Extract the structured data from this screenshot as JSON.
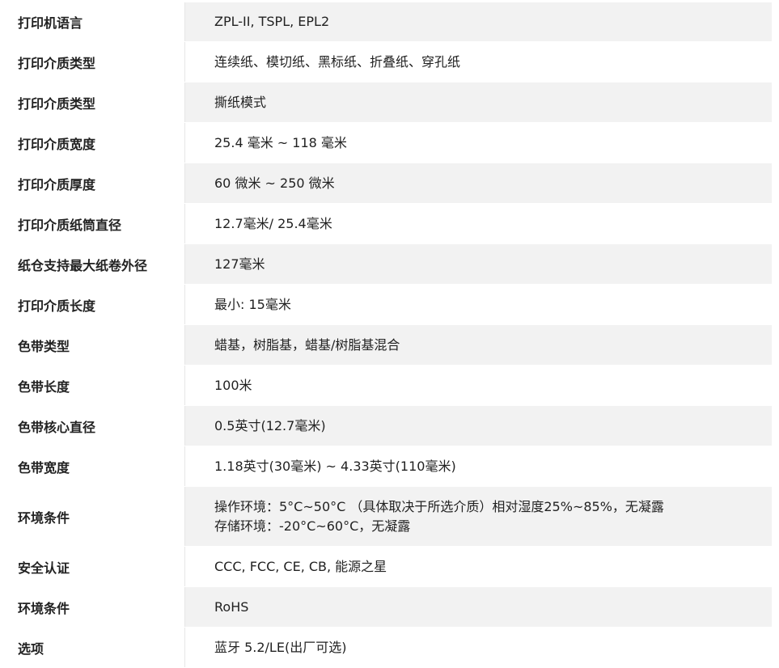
{
  "spec_rows": [
    {
      "label": "打印机语言",
      "values": [
        "ZPL-II, TSPL, EPL2"
      ],
      "height": 48
    },
    {
      "label": "打印介质类型",
      "values": [
        "连续纸、模切纸、黑标纸、折叠纸、穿孔纸"
      ],
      "height": 49
    },
    {
      "label": "打印介质类型",
      "values": [
        "撕纸模式"
      ],
      "height": 49
    },
    {
      "label": "打印介质宽度",
      "values": [
        "25.4 毫米 ~ 118 毫米"
      ],
      "height": 49
    },
    {
      "label": "打印介质厚度",
      "values": [
        "60 微米 ~ 250 微米"
      ],
      "height": 49
    },
    {
      "label": "打印介质纸筒直径",
      "values": [
        "12.7毫米/ 25.4毫米"
      ],
      "height": 49
    },
    {
      "label": "纸仓支持最大纸卷外径",
      "values": [
        "127毫米"
      ],
      "height": 49
    },
    {
      "label": "打印介质长度",
      "values": [
        "最小: 15毫米"
      ],
      "height": 49
    },
    {
      "label": "色带类型",
      "values": [
        "蜡基，树脂基，蜡基/树脂基混合"
      ],
      "height": 49
    },
    {
      "label": "色带长度",
      "values": [
        "100米"
      ],
      "height": 49
    },
    {
      "label": "色带核心直径",
      "values": [
        "0.5英寸(12.7毫米)"
      ],
      "height": 49
    },
    {
      "label": "色带宽度",
      "values": [
        "1.18英寸(30毫米) ~ 4.33英寸(110毫米)"
      ],
      "height": 49
    },
    {
      "label": "环境条件",
      "values": [
        "操作环境：5°C~50°C （具体取决于所选介质）相对湿度25%~85%，无凝露",
        "存储环境：-20°C~60°C，无凝露"
      ],
      "height": 73
    },
    {
      "label": "安全认证",
      "values": [
        "CCC, FCC, CE, CB, 能源之星"
      ],
      "height": 49
    },
    {
      "label": "环境条件",
      "values": [
        "RoHS"
      ],
      "height": 49
    },
    {
      "label": "选项",
      "values": [
        "蓝牙 5.2/LE(出厂可选)"
      ],
      "height": 49
    }
  ]
}
